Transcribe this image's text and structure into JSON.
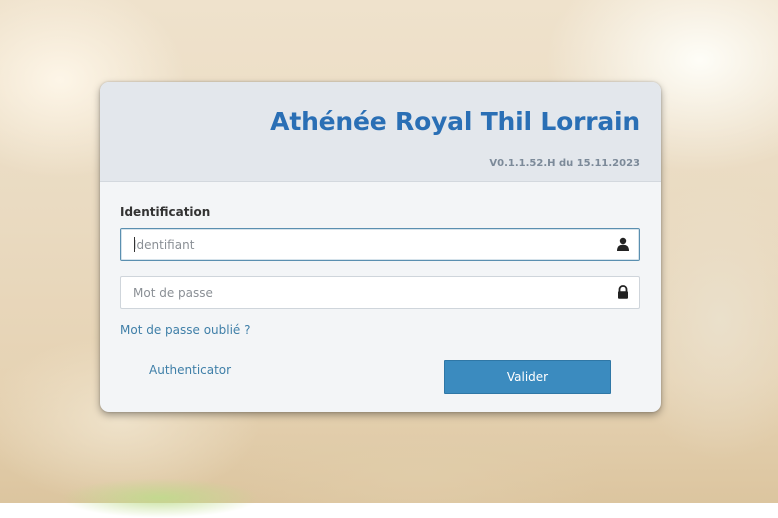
{
  "header": {
    "brand": "Athénée Royal Thil Lorrain",
    "version": "V0.1.1.52.H du 15.11.2023"
  },
  "form": {
    "section_label": "Identification",
    "username": {
      "value": "",
      "placeholder": "Identifiant",
      "icon": "user-icon"
    },
    "password": {
      "value": "",
      "placeholder": "Mot de passe",
      "icon": "lock-icon"
    },
    "forgot_password_label": "Mot de passe oublié ?",
    "authenticator_label": "Authenticator",
    "submit_label": "Valider"
  },
  "colors": {
    "brand": "#2a6fb5",
    "link": "#3f7fa8",
    "button": "#3b8bbf"
  }
}
